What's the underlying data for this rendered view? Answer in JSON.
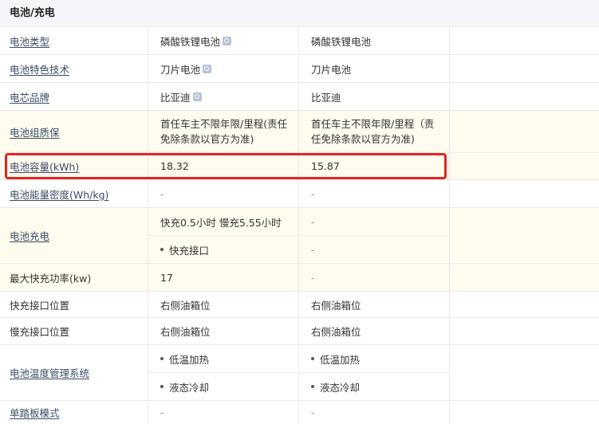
{
  "section": {
    "title": "电池/充电"
  },
  "rows": [
    {
      "label": "电池类型",
      "a": "磷酸铁锂电池",
      "b": "磷酸铁锂电池"
    },
    {
      "label": "电池特色技术",
      "a": "刀片电池",
      "b": "刀片电池"
    },
    {
      "label": "电芯品牌",
      "a": "比亚迪",
      "b": "比亚迪"
    },
    {
      "label": "电池组质保",
      "a": "首任车主不限年限/里程(责任免除条款以官方为准)",
      "b": "首任车主不限年限/里程（责任免除条款以官方为准)"
    },
    {
      "label": "电池容量(kWh)",
      "a": "18.32",
      "b": "15.87"
    },
    {
      "label": "电池能量密度(Wh/kg)",
      "a": "-",
      "b": "-"
    },
    {
      "label": "电池充电",
      "a1": "快充0.5小时 慢充5.55小时",
      "a2": "快充接口",
      "b1": "-",
      "b2": "-"
    },
    {
      "label": "最大快充功率(kw)",
      "a": "17",
      "b": "-"
    },
    {
      "label": "快充接口位置",
      "a": "右侧油箱位",
      "b": "右侧油箱位"
    },
    {
      "label": "慢充接口位置",
      "a": "右侧油箱位",
      "b": "右侧油箱位"
    },
    {
      "label": "电池温度管理系统",
      "a1": "低温加热",
      "a2": "液态冷却",
      "b1": "低温加热",
      "b2": "液态冷却"
    },
    {
      "label": "单踏板模式",
      "a": "-",
      "b": "-"
    }
  ],
  "colors": {
    "highlight_row": "#fffbee",
    "annotation_box": "#e0271f",
    "header_bg": "#f5f6fa"
  }
}
